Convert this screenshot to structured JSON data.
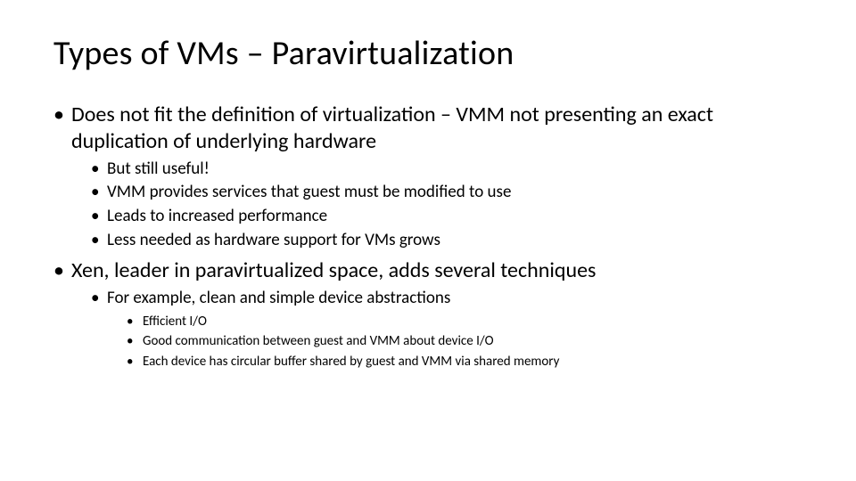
{
  "title": "Types of VMs – Paravirtualization",
  "b1": {
    "text": "Does not fit the definition of virtualization – VMM not presenting an exact duplication of underlying hardware",
    "sub": {
      "s0": "But still useful!",
      "s1": "VMM provides services that guest must be modified to use",
      "s2": "Leads to increased performance",
      "s3": "Less needed as hardware support for VMs grows"
    }
  },
  "b2": {
    "text": "Xen, leader in paravirtualized space, adds several techniques",
    "sub": {
      "s0": {
        "text": "For example, clean and simple device abstractions",
        "sub": {
          "t0": "Efficient I/O",
          "t1": "Good communication between guest and VMM about device I/O",
          "t2": "Each device has circular buffer shared by guest and VMM via shared memory"
        }
      }
    }
  }
}
